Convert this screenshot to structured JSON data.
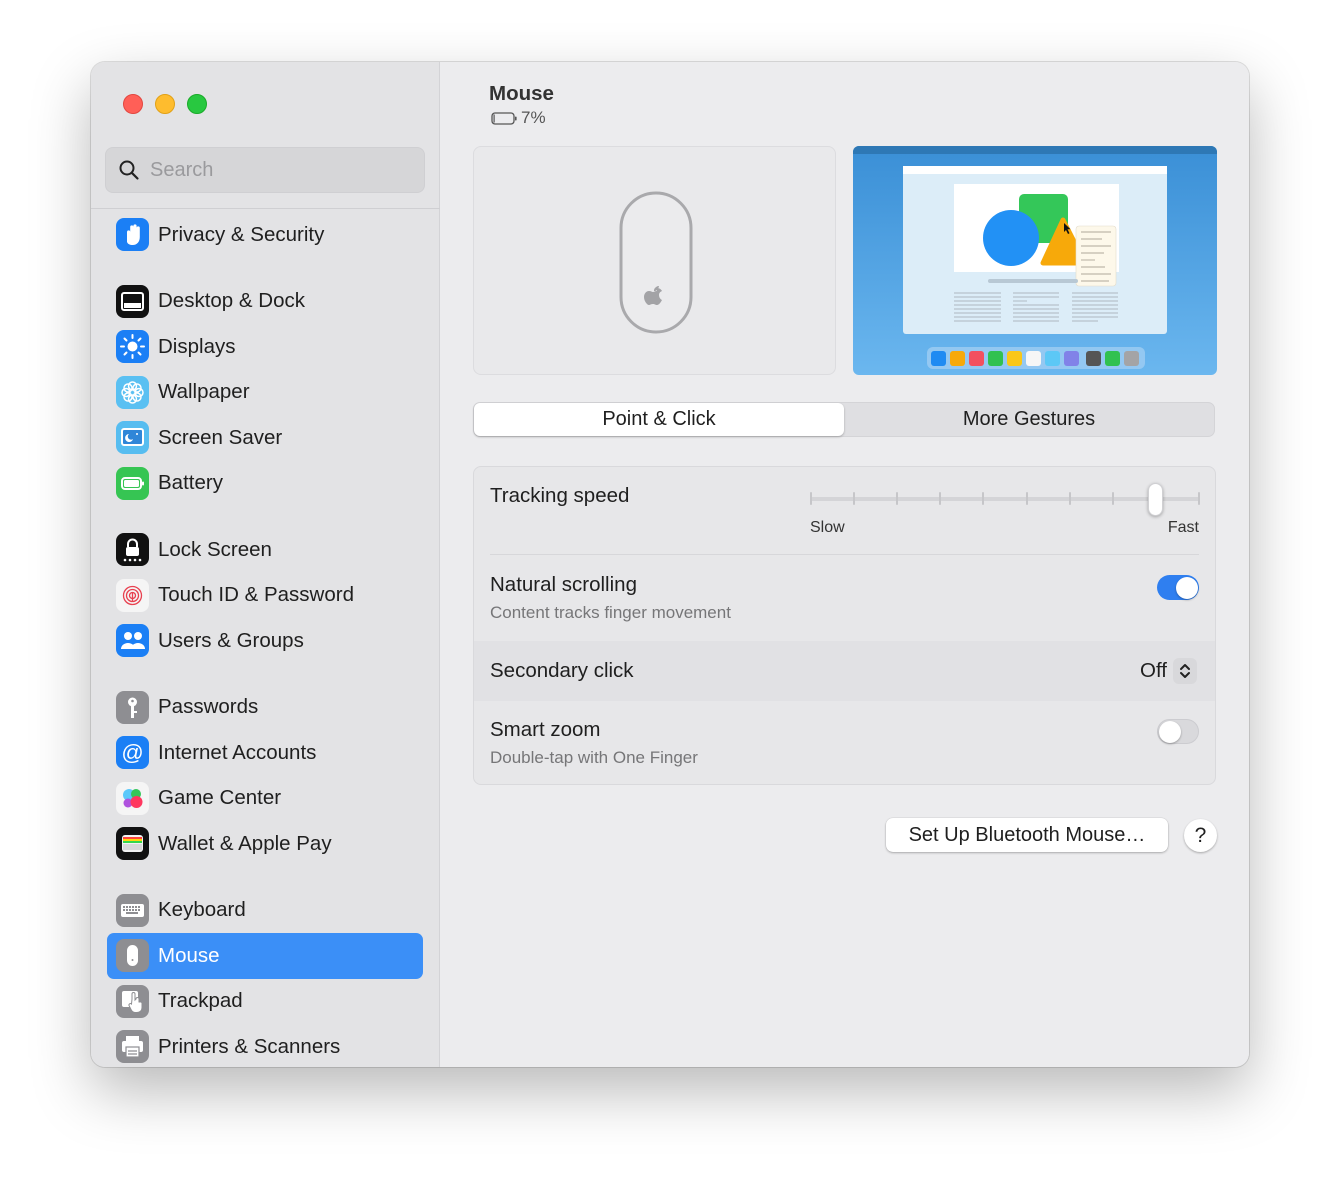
{
  "window": {
    "traffic_lights": [
      "close",
      "minimize",
      "zoom"
    ]
  },
  "sidebar": {
    "search_placeholder": "Search",
    "groups": [
      [
        {
          "label": "Privacy & Security",
          "icon": "hand-icon",
          "color": "#1b7ff5"
        }
      ],
      [
        {
          "label": "Desktop & Dock",
          "icon": "dock-icon",
          "color": "#111111"
        },
        {
          "label": "Displays",
          "icon": "sun-icon",
          "color": "#1b7ff5"
        },
        {
          "label": "Wallpaper",
          "icon": "flower-icon",
          "color": "#5ac0f2"
        },
        {
          "label": "Screen Saver",
          "icon": "screensaver-icon",
          "color": "#57bdf0"
        },
        {
          "label": "Battery",
          "icon": "battery-icon",
          "color": "#36c553"
        }
      ],
      [
        {
          "label": "Lock Screen",
          "icon": "lock-icon",
          "color": "#111111"
        },
        {
          "label": "Touch ID & Password",
          "icon": "fingerprint-icon",
          "color": "#f5f5f5"
        },
        {
          "label": "Users & Groups",
          "icon": "users-icon",
          "color": "#1b7ff5"
        }
      ],
      [
        {
          "label": "Passwords",
          "icon": "key-icon",
          "color": "#8e8e92"
        },
        {
          "label": "Internet Accounts",
          "icon": "at-icon",
          "color": "#1b7ff5"
        },
        {
          "label": "Game Center",
          "icon": "game-center-icon",
          "color": "#f5f5f5"
        },
        {
          "label": "Wallet & Apple Pay",
          "icon": "wallet-icon",
          "color": "#111111"
        }
      ],
      [
        {
          "label": "Keyboard",
          "icon": "keyboard-icon",
          "color": "#8e8e92"
        },
        {
          "label": "Mouse",
          "icon": "mouse-icon",
          "color": "#8e8e92",
          "active": true
        },
        {
          "label": "Trackpad",
          "icon": "trackpad-icon",
          "color": "#8e8e92"
        },
        {
          "label": "Printers & Scanners",
          "icon": "printer-icon",
          "color": "#8e8e92"
        }
      ]
    ],
    "active_color": "#3b8ff7"
  },
  "main": {
    "title": "Mouse",
    "battery_level": "7%",
    "tabs": [
      {
        "label": "Point & Click",
        "active": true
      },
      {
        "label": "More Gestures",
        "active": false
      }
    ],
    "tracking_speed": {
      "label": "Tracking speed",
      "min_label": "Slow",
      "max_label": "Fast",
      "ticks": 10,
      "value_fraction": 0.889
    },
    "natural_scrolling": {
      "label": "Natural scrolling",
      "description": "Content tracks finger movement",
      "enabled": true
    },
    "secondary_click": {
      "label": "Secondary click",
      "value": "Off"
    },
    "smart_zoom": {
      "label": "Smart zoom",
      "description": "Double-tap with One Finger",
      "enabled": false
    },
    "setup_button": "Set Up Bluetooth Mouse…",
    "help_button": "?",
    "accent_color": "#2f7ff0"
  }
}
